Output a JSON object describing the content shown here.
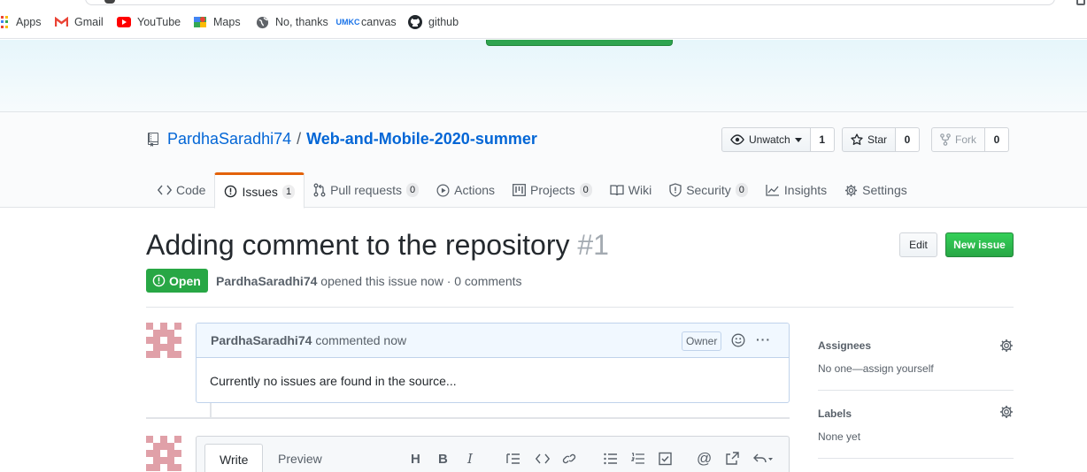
{
  "bookmarks": [
    {
      "label": "Apps",
      "icon": "apps-icon"
    },
    {
      "label": "Gmail",
      "icon": "gmail-icon"
    },
    {
      "label": "YouTube",
      "icon": "youtube-icon"
    },
    {
      "label": "Maps",
      "icon": "maps-icon"
    },
    {
      "label": "No, thanks",
      "icon": "globe-icon"
    },
    {
      "label": "canvas",
      "icon": "canvas-icon"
    },
    {
      "label": "github",
      "icon": "github-icon"
    }
  ],
  "repo": {
    "owner": "PardhaSaradhi74",
    "separator": "/",
    "name": "Web-and-Mobile-2020-summer",
    "watch_label": "Unwatch",
    "watch_count": "1",
    "star_label": "Star",
    "star_count": "0",
    "fork_label": "Fork",
    "fork_count": "0"
  },
  "tabs": [
    {
      "label": "Code",
      "icon": "code-icon"
    },
    {
      "label": "Issues",
      "icon": "issue-opened-icon",
      "count": "1",
      "selected": true
    },
    {
      "label": "Pull requests",
      "icon": "git-pull-request-icon",
      "count": "0"
    },
    {
      "label": "Actions",
      "icon": "play-icon"
    },
    {
      "label": "Projects",
      "icon": "project-icon",
      "count": "0"
    },
    {
      "label": "Wiki",
      "icon": "book-icon"
    },
    {
      "label": "Security",
      "icon": "shield-icon",
      "count": "0"
    },
    {
      "label": "Insights",
      "icon": "graph-icon"
    },
    {
      "label": "Settings",
      "icon": "gear-icon"
    }
  ],
  "issue": {
    "title": "Adding comment to the repository",
    "number": "#1",
    "edit_label": "Edit",
    "new_issue_label": "New issue",
    "state": "Open",
    "author": "PardhaSaradhi74",
    "meta_text": "opened this issue now · 0 comments"
  },
  "comment": {
    "author": "PardhaSaradhi74",
    "action": "commented now",
    "badge": "Owner",
    "more": "···",
    "body": "Currently no issues are found in the source..."
  },
  "editor": {
    "write_tab": "Write",
    "preview_tab": "Preview",
    "toolbar": [
      {
        "icon": "heading-icon",
        "glyph": "H"
      },
      {
        "icon": "bold-icon",
        "glyph": "B"
      },
      {
        "icon": "italic-icon",
        "glyph": "I"
      },
      {
        "icon": "quote-icon"
      },
      {
        "icon": "code-icon"
      },
      {
        "icon": "link-icon"
      },
      {
        "icon": "unordered-list-icon"
      },
      {
        "icon": "ordered-list-icon"
      },
      {
        "icon": "task-list-icon"
      },
      {
        "icon": "mention-icon",
        "glyph": "@"
      },
      {
        "icon": "cross-reference-icon"
      },
      {
        "icon": "reply-icon"
      }
    ]
  },
  "sidebar": {
    "assignees_label": "Assignees",
    "assignees_value": "No one—assign yourself",
    "labels_label": "Labels",
    "labels_value": "None yet"
  },
  "colors": {
    "accent_blue": "#0366d6",
    "open_green": "#28a745",
    "selected_tab_orange": "#e36209"
  }
}
